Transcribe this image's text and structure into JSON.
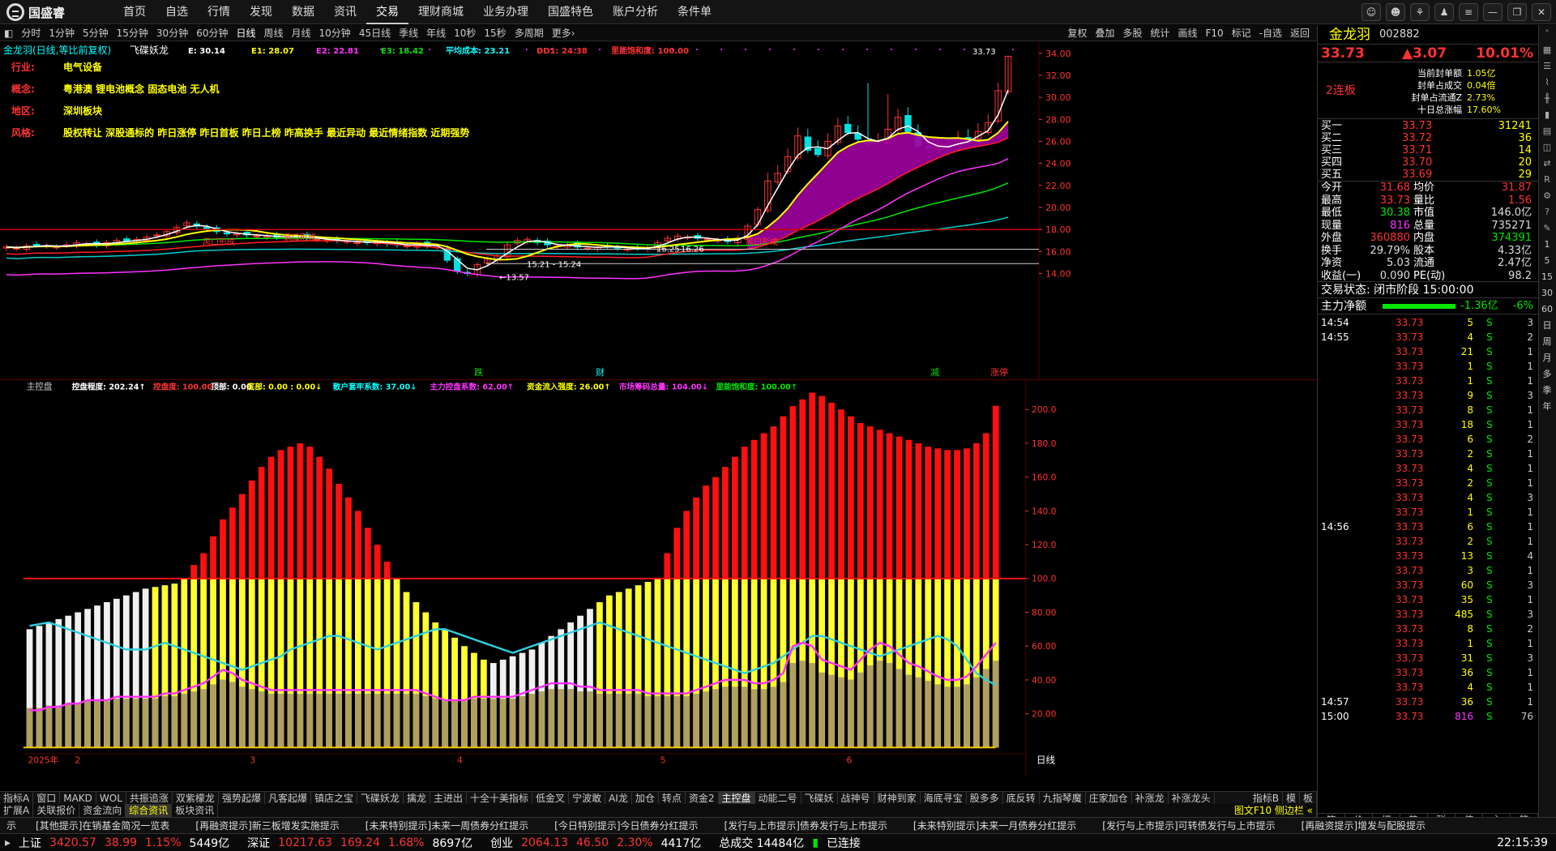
{
  "app": {
    "logo_text": "国盛睿"
  },
  "menu": [
    "首页",
    "自选",
    "行情",
    "发现",
    "数据",
    "资讯",
    "交易",
    "理财商城",
    "业务办理",
    "国盛特色",
    "账户分析",
    "条件单"
  ],
  "menu_active": 6,
  "window_controls": [
    "chat-icon",
    "user-icon",
    "logo-icon",
    "shirt-icon",
    "menu-icon",
    "minimize-icon",
    "restore-icon",
    "close-icon"
  ],
  "timeframes": [
    "分时",
    "1分钟",
    "5分钟",
    "15分钟",
    "30分钟",
    "60分钟",
    "日线",
    "周线",
    "月线",
    "10分钟",
    "45日线",
    "季线",
    "年线",
    "10秒",
    "15秒",
    "多周期",
    "更多›"
  ],
  "timeframe_active": 6,
  "toolbar_right": [
    "复权",
    "叠加",
    "多股",
    "统计",
    "画线",
    "F10",
    "标记",
    "-自选",
    "返回"
  ],
  "chart_header": {
    "name": "金龙羽(日线,等比前复权)",
    "indicator": "飞碟妖龙",
    "values": [
      {
        "label": "E: 30.14",
        "color": "#ffffff"
      },
      {
        "label": "E1: 28.07",
        "color": "#ffff00"
      },
      {
        "label": "E2: 22.81",
        "color": "#ff33ff"
      },
      {
        "label": "E3: 18.42",
        "color": "#00e600"
      },
      {
        "label": "平均成本: 23.21",
        "color": "#00ffff"
      },
      {
        "label": "DD1: 24.38",
        "color": "#ff3232"
      },
      {
        "label": "里能饱和度: 100.00",
        "color": "#ff3232"
      }
    ]
  },
  "info_lines": [
    {
      "label": "行业:",
      "value": "电气设备"
    },
    {
      "label": "概念:",
      "value": "粤港澳 锂电池概念 固态电池 无人机"
    },
    {
      "label": "地区:",
      "value": "深圳板块"
    },
    {
      "label": "风格:",
      "value": "股权转让 深股通标的 昨日涨停 昨日首板 昨日上榜 昨高换手 最近异动 最近情绪指数 近期强势"
    }
  ],
  "price_axis": [
    "34.00",
    "32.00",
    "30.00",
    "28.00",
    "26.00",
    "24.00",
    "22.00",
    "20.00",
    "18.00",
    "16.00",
    "14.00"
  ],
  "chart_annotations": [
    {
      "text": "33.73",
      "color": "#ffffff"
    },
    {
      "text": "15.21 - 15.24",
      "color": "#ffffff"
    },
    {
      "text": "16.25",
      "color": "#ffffff"
    },
    {
      "text": "16.26",
      "color": "#ffffff"
    },
    {
      "text": "←13.57",
      "color": "#ffffff"
    },
    {
      "text": "风口形成",
      "color": "#ff3232"
    },
    {
      "text": "风口形成",
      "color": "#ff3232"
    },
    {
      "text": "风口形成",
      "color": "#ff3232"
    },
    {
      "text": "跌",
      "color": "#00e600"
    },
    {
      "text": "财",
      "color": "#00ffff"
    },
    {
      "text": "减",
      "color": "#00e600"
    },
    {
      "text": "涨停",
      "color": "#ff3232"
    }
  ],
  "osc_header": {
    "name": "主控盘",
    "values": [
      {
        "label": "控盘程度: 202.24↑",
        "color": "#ffffff"
      },
      {
        "label": "控盘度: 100.00",
        "color": "#ff3232"
      },
      {
        "label": "顶部: 0.00",
        "color": "#ffffff"
      },
      {
        "label": "底部: 0.00 : 0.00↓",
        "color": "#ffff00"
      },
      {
        "label": "散户套牢系数: 37.00↓",
        "color": "#00ffff"
      },
      {
        "label": "主力控盘系数: 62.00↑",
        "color": "#ff33ff"
      },
      {
        "label": "资金流入强度: 26.00↑",
        "color": "#ffff00"
      },
      {
        "label": "市场筹码总量: 104.00↓",
        "color": "#ff33ff"
      },
      {
        "label": "里能饱和度: 100.00↑",
        "color": "#00e600"
      }
    ]
  },
  "osc_axis": [
    "200.0",
    "180.0",
    "160.0",
    "140.0",
    "120.0",
    "100.0",
    "80.00",
    "60.00",
    "40.00",
    "20.00"
  ],
  "date_axis": [
    "2025年",
    "2",
    "3",
    "4",
    "5",
    "6"
  ],
  "period_label": "日线",
  "indicator_tabs": [
    "指标A",
    "窗口",
    "MAKD",
    "WOL",
    "共振追涨",
    "双紫檬龙",
    "强势起爆",
    "凡客起爆",
    "镇店之宝",
    "飞碟妖龙",
    "擒龙",
    "主进出",
    "十全十美指标",
    "低金叉",
    "宁波敢",
    "AI龙",
    "加仓",
    "转点",
    "资金2",
    "主控盘",
    "动能二号",
    "飞碟妖",
    "战神号",
    "财神到家",
    "海底寻宝",
    "股多多",
    "底反转",
    "九指琴魔",
    "庄家加仓",
    "补涨龙",
    "补涨龙头"
  ],
  "indicator_tab_active": 19,
  "indicator_tabs_right": [
    "指标B",
    "模",
    "板"
  ],
  "sub_tabs": [
    "扩展A",
    "关联报价",
    "资金流向",
    "综合资讯",
    "板块资讯"
  ],
  "sub_tab_active": 3,
  "sub_tabs_right": "图文F10 侧边栏 «",
  "stock": {
    "name": "金龙羽",
    "code": "002882",
    "price": "33.73",
    "change": "▲3.07",
    "pct": "10.01%",
    "streak": "2连板",
    "seal": [
      {
        "label": "当前封单额",
        "value": "1.05亿"
      },
      {
        "label": "封单占成交",
        "value": "0.04倍"
      },
      {
        "label": "封单占流通Z",
        "value": "2.73%"
      },
      {
        "label": "十日总涨幅",
        "value": "17.60%"
      }
    ]
  },
  "orderbook": [
    {
      "label": "买一",
      "price": "33.73",
      "vol": "31241"
    },
    {
      "label": "买二",
      "price": "33.72",
      "vol": "36"
    },
    {
      "label": "买三",
      "price": "33.71",
      "vol": "14"
    },
    {
      "label": "买四",
      "price": "33.70",
      "vol": "20"
    },
    {
      "label": "买五",
      "price": "33.69",
      "vol": "29"
    }
  ],
  "quote_grid": [
    {
      "l1": "今开",
      "v1": "31.68",
      "c1": "#ff3232",
      "l2": "均价",
      "v2": "31.87",
      "c2": "#ff3232"
    },
    {
      "l1": "最高",
      "v1": "33.73",
      "c1": "#ff3232",
      "l2": "量比",
      "v2": "1.56",
      "c2": "#ff3232"
    },
    {
      "l1": "最低",
      "v1": "30.38",
      "c1": "#00e600",
      "l2": "市值",
      "v2": "146.0亿",
      "c2": "#dddddd"
    },
    {
      "l1": "现量",
      "v1": "816",
      "c1": "#ff33ff",
      "l2": "总量",
      "v2": "735271",
      "c2": "#dddddd"
    },
    {
      "l1": "外盘",
      "v1": "360880",
      "c1": "#ff3232",
      "l2": "内盘",
      "v2": "374391",
      "c2": "#00e600"
    },
    {
      "l1": "换手",
      "v1": "29.79%",
      "c1": "#dddddd",
      "l2": "股本",
      "v2": "4.33亿",
      "c2": "#dddddd"
    },
    {
      "l1": "净资",
      "v1": "5.03",
      "c1": "#dddddd",
      "l2": "流通",
      "v2": "2.47亿",
      "c2": "#dddddd"
    },
    {
      "l1": "收益(一)",
      "v1": "0.090",
      "c1": "#dddddd",
      "l2": "PE(动)",
      "v2": "98.2",
      "c2": "#dddddd"
    }
  ],
  "trade_status": "交易状态: 闭市阶段 15:00:00",
  "net_flow": {
    "label": "主力净额",
    "value": "-1.36亿",
    "pct": "-6%",
    "level": 0.6
  },
  "ticks": [
    {
      "time": "14:54",
      "price": "33.73",
      "vol": "5",
      "side": "S",
      "n": "3"
    },
    {
      "time": "14:55",
      "price": "33.73",
      "vol": "4",
      "side": "S",
      "n": "2"
    },
    {
      "time": "",
      "price": "33.73",
      "vol": "21",
      "side": "S",
      "n": "1"
    },
    {
      "time": "",
      "price": "33.73",
      "vol": "1",
      "side": "S",
      "n": "1"
    },
    {
      "time": "",
      "price": "33.73",
      "vol": "1",
      "side": "S",
      "n": "1"
    },
    {
      "time": "",
      "price": "33.73",
      "vol": "9",
      "side": "S",
      "n": "3"
    },
    {
      "time": "",
      "price": "33.73",
      "vol": "8",
      "side": "S",
      "n": "1"
    },
    {
      "time": "",
      "price": "33.73",
      "vol": "18",
      "side": "S",
      "n": "1"
    },
    {
      "time": "",
      "price": "33.73",
      "vol": "6",
      "side": "S",
      "n": "2"
    },
    {
      "time": "",
      "price": "33.73",
      "vol": "2",
      "side": "S",
      "n": "1"
    },
    {
      "time": "",
      "price": "33.73",
      "vol": "4",
      "side": "S",
      "n": "1"
    },
    {
      "time": "",
      "price": "33.73",
      "vol": "2",
      "side": "S",
      "n": "1"
    },
    {
      "time": "",
      "price": "33.73",
      "vol": "4",
      "side": "S",
      "n": "3"
    },
    {
      "time": "",
      "price": "33.73",
      "vol": "1",
      "side": "S",
      "n": "1"
    },
    {
      "time": "14:56",
      "price": "33.73",
      "vol": "6",
      "side": "S",
      "n": "1"
    },
    {
      "time": "",
      "price": "33.73",
      "vol": "2",
      "side": "S",
      "n": "1"
    },
    {
      "time": "",
      "price": "33.73",
      "vol": "13",
      "side": "S",
      "n": "4"
    },
    {
      "time": "",
      "price": "33.73",
      "vol": "3",
      "side": "S",
      "n": "1"
    },
    {
      "time": "",
      "price": "33.73",
      "vol": "60",
      "side": "S",
      "n": "3"
    },
    {
      "time": "",
      "price": "33.73",
      "vol": "35",
      "side": "S",
      "n": "1"
    },
    {
      "time": "",
      "price": "33.73",
      "vol": "485",
      "side": "S",
      "n": "3"
    },
    {
      "time": "",
      "price": "33.73",
      "vol": "8",
      "side": "S",
      "n": "2"
    },
    {
      "time": "",
      "price": "33.73",
      "vol": "1",
      "side": "S",
      "n": "1"
    },
    {
      "time": "",
      "price": "33.73",
      "vol": "31",
      "side": "S",
      "n": "3"
    },
    {
      "time": "",
      "price": "33.73",
      "vol": "36",
      "side": "S",
      "n": "1"
    },
    {
      "time": "",
      "price": "33.73",
      "vol": "4",
      "side": "S",
      "n": "1"
    },
    {
      "time": "14:57",
      "price": "33.73",
      "vol": "36",
      "side": "S",
      "n": "1"
    },
    {
      "time": "15:00",
      "price": "33.73",
      "vol": "816",
      "side": "S",
      "n": "76"
    }
  ],
  "right_bottom_tabs": [
    "笔",
    "价",
    "细",
    "势",
    "联",
    "值",
    "主",
    "筹"
  ],
  "right_side_labels": [
    "1",
    "5",
    "15",
    "30",
    "60",
    "日",
    "周",
    "月",
    "多",
    "季",
    "年"
  ],
  "news": [
    "[其他提示]在销基金简况一览表",
    "[再融资提示]新三板增发实施提示",
    "[未来特别提示]未来一周债券分红提示",
    "[今日特别提示]今日债券分红提示",
    "[发行与上市提示]债券发行与上市提示",
    "[未来特别提示]未来一月债券分红提示",
    "[发行与上市提示]可转债发行与上市提示",
    "[再融资提示]增发与配股提示"
  ],
  "indices": [
    {
      "name": "上证",
      "value": "3420.57",
      "chg": "38.99",
      "pct": "1.15%",
      "amt": "5449亿"
    },
    {
      "name": "深证",
      "value": "10217.63",
      "chg": "169.24",
      "pct": "1.68%",
      "amt": "8697亿"
    },
    {
      "name": "创业",
      "value": "2064.13",
      "chg": "46.50",
      "pct": "2.30%",
      "amt": "4417亿"
    }
  ],
  "total_turnover": "总成交 14484亿",
  "connection": "已连接",
  "clock": "22:15:39",
  "colors": {
    "up": "#ff3232",
    "down": "#00e600",
    "ma_white": "#ffffff",
    "ma_yellow": "#ffff00",
    "ma_magenta": "#ff33ff",
    "ma_cyan": "#00ffff"
  },
  "chart_data": [
    {
      "type": "candlestick",
      "title": "金龙羽(日线,等比前复权)",
      "ylim": [
        13,
        34.5
      ],
      "grid": false,
      "close": [
        16.4,
        16.3,
        16.5,
        16.6,
        16.5,
        16.4,
        16.6,
        16.8,
        16.7,
        16.6,
        16.8,
        17.0,
        16.9,
        17.1,
        17.3,
        17.5,
        17.8,
        18.2,
        18.6,
        18.3,
        18.0,
        17.8,
        17.6,
        17.6,
        17.5,
        17.4,
        17.4,
        17.3,
        17.3,
        17.4,
        17.2,
        17.1,
        17.0,
        17.0,
        16.9,
        16.8,
        16.8,
        16.9,
        16.7,
        16.6,
        16.5,
        16.7,
        16.5,
        16.4,
        15.2,
        14.2,
        14.0,
        14.8,
        15.3,
        15.6,
        16.6,
        17.0,
        17.1,
        16.8,
        16.6,
        16.5,
        16.6,
        16.4,
        16.3,
        16.4,
        16.5,
        16.3,
        16.2,
        16.3,
        16.3,
        16.8,
        17.2,
        17.4,
        17.3,
        17.2,
        17.1,
        17.0,
        16.9,
        17.2,
        18.3,
        19.8,
        22.4,
        23.1,
        24.6,
        26.5,
        25.2,
        24.8,
        26.0,
        27.4,
        26.8,
        26.2,
        25.8,
        26.0,
        27.1,
        28.2,
        26.9,
        25.6,
        25.4,
        25.7,
        25.4,
        26.2,
        26.3,
        26.9,
        27.7,
        30.6,
        33.73
      ],
      "ma_lines": [
        {
          "name": "E",
          "color": "#ffffff"
        },
        {
          "name": "E1",
          "color": "#ffff00"
        },
        {
          "name": "E2",
          "color": "#ff33ff"
        },
        {
          "name": "E3",
          "color": "#00e600"
        },
        {
          "name": "平均成本",
          "color": "#00ffff"
        }
      ]
    },
    {
      "type": "bar",
      "title": "主控盘",
      "ylim": [
        0,
        210
      ],
      "control_degree": [
        70,
        72,
        74,
        76,
        78,
        80,
        82,
        84,
        86,
        88,
        90,
        92,
        94,
        95,
        96,
        97,
        100,
        108,
        115,
        125,
        135,
        142,
        150,
        158,
        166,
        172,
        176,
        178,
        180,
        178,
        172,
        165,
        156,
        148,
        140,
        130,
        120,
        110,
        100,
        92,
        86,
        80,
        74,
        70,
        65,
        60,
        56,
        52,
        50,
        52,
        54,
        56,
        58,
        62,
        66,
        70,
        74,
        78,
        82,
        86,
        90,
        92,
        94,
        96,
        98,
        100,
        115,
        130,
        140,
        148,
        155,
        160,
        166,
        172,
        178,
        182,
        186,
        190,
        196,
        202,
        206,
        210,
        208,
        204,
        200,
        196,
        192,
        190,
        188,
        186,
        184,
        182,
        180,
        178,
        177,
        176,
        176,
        177,
        180,
        186,
        202.24
      ],
      "retail_line": [
        72,
        73,
        74,
        72,
        70,
        68,
        66,
        64,
        62,
        60,
        58,
        58,
        58,
        60,
        62,
        60,
        58,
        56,
        54,
        52,
        50,
        48,
        46,
        48,
        50,
        52,
        54,
        58,
        60,
        62,
        64,
        66,
        66,
        64,
        62,
        60,
        58,
        60,
        62,
        64,
        66,
        68,
        70,
        70,
        68,
        66,
        64,
        62,
        60,
        58,
        56,
        58,
        60,
        62,
        64,
        66,
        68,
        70,
        72,
        74,
        72,
        70,
        68,
        66,
        64,
        62,
        60,
        58,
        56,
        54,
        52,
        50,
        48,
        46,
        44,
        46,
        48,
        50,
        54,
        58,
        62,
        66,
        66,
        64,
        62,
        60,
        58,
        56,
        54,
        56,
        58,
        60,
        62,
        64,
        66,
        64,
        60,
        52,
        44,
        40,
        37
      ],
      "main_line": [
        22,
        22,
        24,
        24,
        26,
        26,
        28,
        28,
        28,
        30,
        30,
        30,
        30,
        30,
        32,
        32,
        34,
        36,
        38,
        42,
        46,
        44,
        40,
        38,
        36,
        34,
        34,
        34,
        34,
        34,
        34,
        34,
        34,
        34,
        34,
        34,
        34,
        34,
        34,
        34,
        34,
        32,
        30,
        28,
        28,
        28,
        30,
        30,
        30,
        30,
        30,
        32,
        34,
        36,
        38,
        38,
        38,
        36,
        36,
        34,
        34,
        34,
        34,
        34,
        32,
        32,
        32,
        32,
        32,
        34,
        36,
        38,
        40,
        40,
        40,
        38,
        38,
        40,
        44,
        60,
        62,
        60,
        52,
        50,
        48,
        46,
        52,
        58,
        62,
        60,
        55,
        50,
        48,
        45,
        42,
        40,
        40,
        42,
        48,
        55,
        62
      ]
    }
  ]
}
